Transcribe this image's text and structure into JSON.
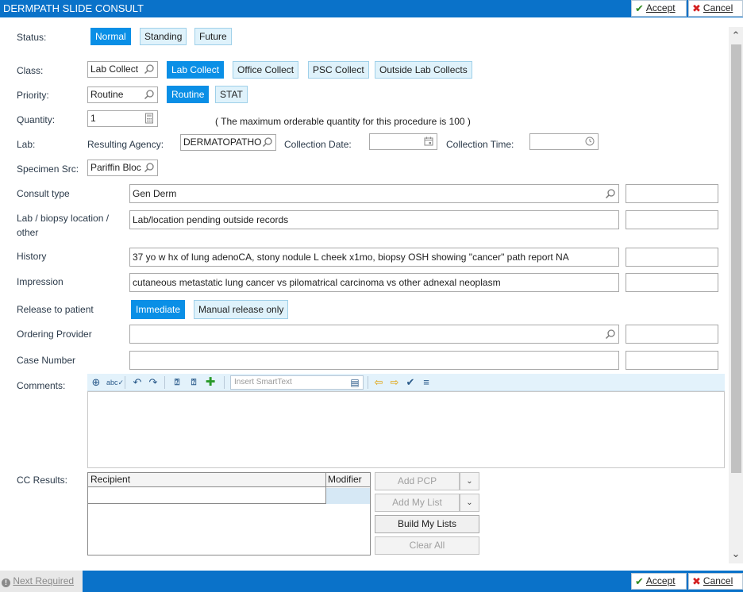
{
  "window": {
    "title": "DERMPATH SLIDE CONSULT",
    "accept": "Accept",
    "cancel": "Cancel"
  },
  "status": {
    "label": "Status:",
    "options": [
      "Normal",
      "Standing",
      "Future"
    ],
    "selected": "Normal"
  },
  "class": {
    "label": "Class:",
    "value": "Lab Collect",
    "options": [
      "Lab Collect",
      "Office Collect",
      "PSC Collect",
      "Outside Lab Collects"
    ],
    "selected": "Lab Collect"
  },
  "priority": {
    "label": "Priority:",
    "value": "Routine",
    "options": [
      "Routine",
      "STAT"
    ],
    "selected": "Routine"
  },
  "quantity": {
    "label": "Quantity:",
    "value": "1",
    "note": "( The maximum orderable quantity for this procedure is 100 )"
  },
  "lab": {
    "label": "Lab:",
    "agency_label": "Resulting Agency:",
    "agency_value": "DERMATOPATHO",
    "date_label": "Collection Date:",
    "date_value": "",
    "time_label": "Collection Time:",
    "time_value": ""
  },
  "specimen": {
    "label": "Specimen Src:",
    "value": "Pariffin Bloc"
  },
  "consult_type": {
    "label": "Consult type",
    "value": "Gen Derm"
  },
  "biopsy": {
    "label1": "Lab / biopsy location /",
    "label2": "other",
    "value": "Lab/location pending outside records"
  },
  "history": {
    "label": "History",
    "value": "37 yo w hx of lung adenoCA, stony nodule L cheek x1mo, biopsy OSH showing \"cancer\" path report NA"
  },
  "impression": {
    "label": "Impression",
    "value": "cutaneous metastatic lung cancer vs pilomatrical carcinoma vs other adnexal neoplasm"
  },
  "release": {
    "label": "Release to patient",
    "options": [
      "Immediate",
      "Manual release only"
    ],
    "selected": "Immediate"
  },
  "ordering": {
    "label": "Ordering Provider",
    "value": ""
  },
  "case": {
    "label": "Case Number",
    "value": ""
  },
  "comments": {
    "label": "Comments:",
    "smarttext_placeholder": "Insert SmartText"
  },
  "cc": {
    "label": "CC Results:",
    "col_recipient": "Recipient",
    "col_modifier": "Modifier",
    "buttons": {
      "add_pcp": "Add PCP",
      "add_my_list": "Add My List",
      "build_my_lists": "Build My Lists",
      "clear_all": "Clear All"
    }
  },
  "footer": {
    "next_required": "Next Required",
    "accept": "Accept",
    "cancel": "Cancel"
  },
  "colors": {
    "title_blue": "#0a72c9",
    "toggle_on": "#0a8fe6",
    "toggle_off": "#dff2fb"
  }
}
